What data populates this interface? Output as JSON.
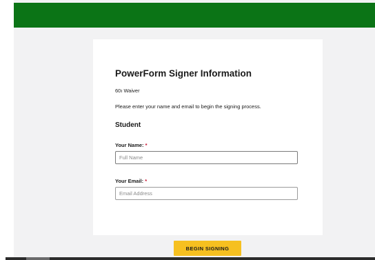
{
  "colors": {
    "header": "#0b7416",
    "page_background": "#f2f2f3",
    "card_background": "#ffffff",
    "button": "#f6c020",
    "required_marker": "#c8102e"
  },
  "form": {
    "title": "PowerForm Signer Information",
    "document_name": "60ı Waiver",
    "instructions": "Please enter your name and email to begin the signing process.",
    "section_title": "Student",
    "name_field": {
      "label": "Your Name:",
      "required_marker": "*",
      "value": "",
      "placeholder": "Full Name"
    },
    "email_field": {
      "label": "Your Email:",
      "required_marker": "*",
      "value": "",
      "placeholder": "Email Address"
    }
  },
  "actions": {
    "begin_label": "BEGIN SIGNING"
  }
}
